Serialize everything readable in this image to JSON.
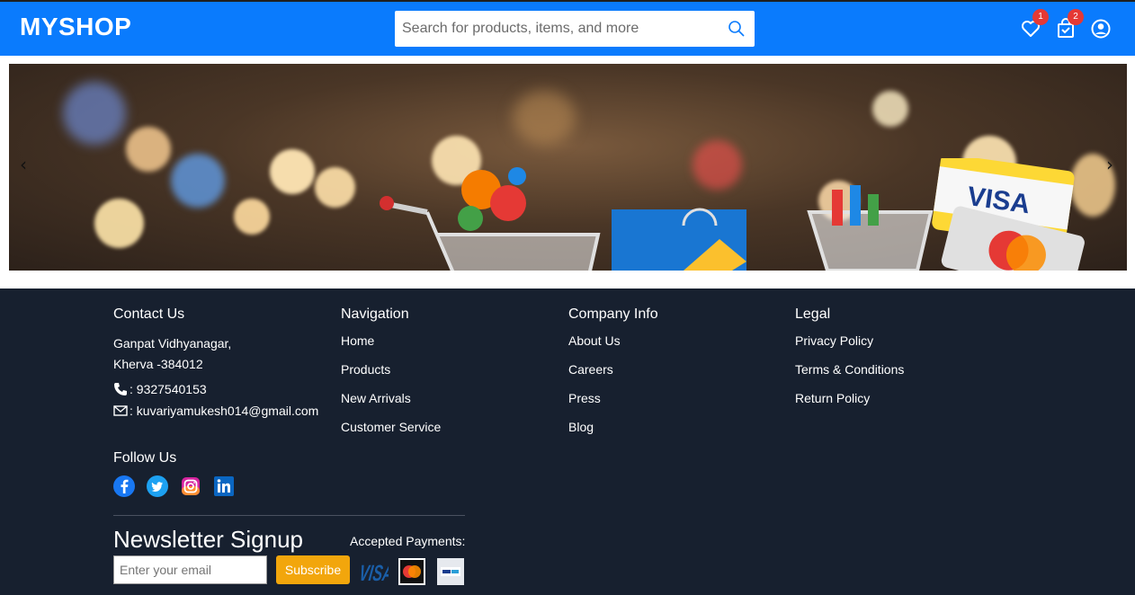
{
  "header": {
    "brand": "MYSHOP",
    "search_placeholder": "Search for products, items, and more",
    "wishlist_count": "1",
    "cart_count": "2",
    "accent_color": "#0a7bfd"
  },
  "banner": {
    "prev_arrow": "‹",
    "next_arrow": "›"
  },
  "footer": {
    "contact": {
      "title": "Contact Us",
      "address_line1": "Ganpat Vidhyanagar,",
      "address_line2": "Kherva -384012",
      "phone": ": 9327540153",
      "email": ": kuvariyamukesh014@gmail.com"
    },
    "navigation": {
      "title": "Navigation",
      "items": [
        "Home",
        "Products",
        "New Arrivals",
        "Customer Service"
      ]
    },
    "company": {
      "title": "Company Info",
      "items": [
        "About Us",
        "Careers",
        "Press",
        "Blog"
      ]
    },
    "legal": {
      "title": "Legal",
      "items": [
        "Privacy Policy",
        "Terms & Conditions",
        "Return Policy"
      ]
    },
    "follow": {
      "title": "Follow Us",
      "icons": [
        "facebook-icon",
        "twitter-icon",
        "instagram-icon",
        "linkedin-icon"
      ]
    },
    "newsletter": {
      "title": "Newsletter Signup",
      "email_placeholder": "Enter your email",
      "subscribe_label": "Subscribe",
      "payments_label": "Accepted Payments:",
      "payment_icons": [
        "visa-icon",
        "mastercard-icon",
        "paypal-icon"
      ]
    }
  }
}
